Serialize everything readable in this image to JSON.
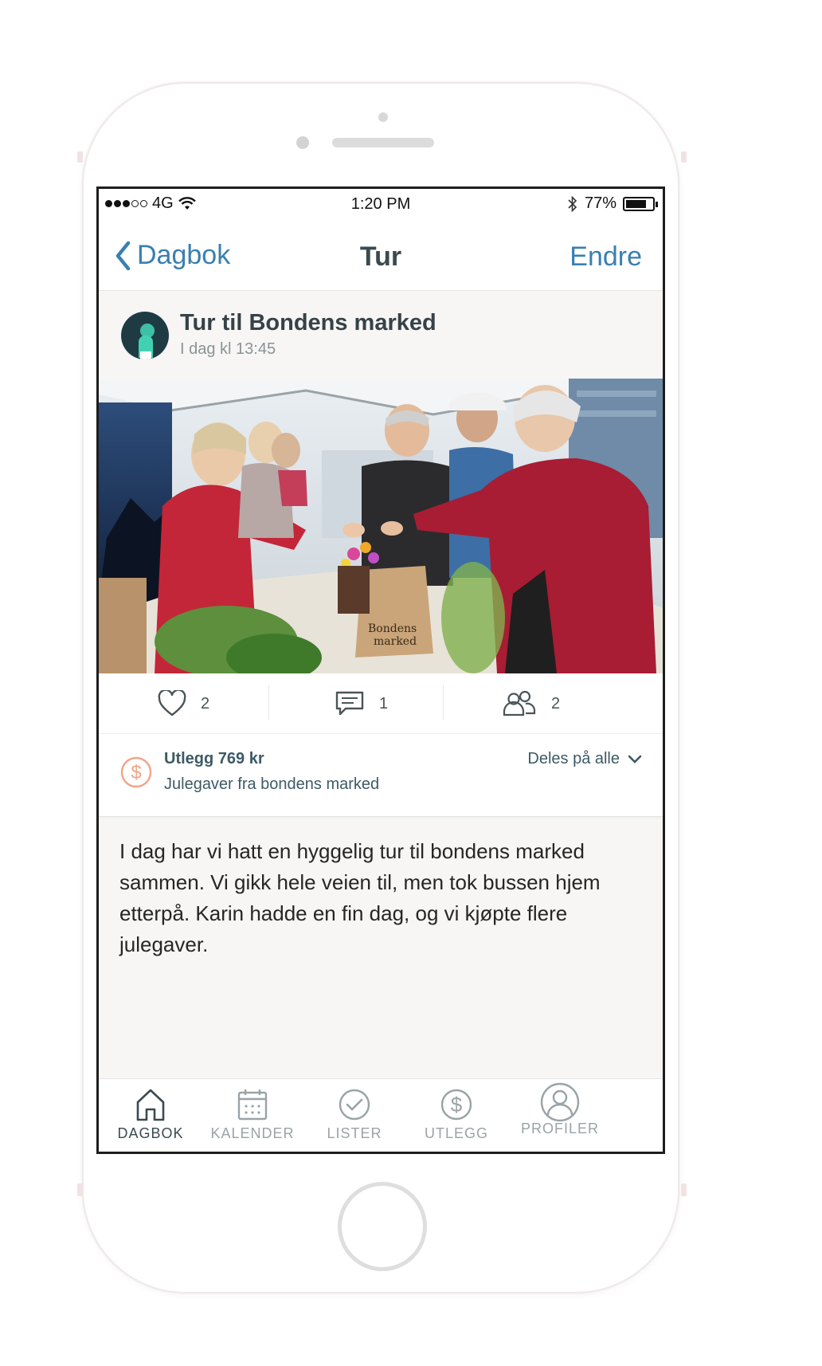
{
  "statusbar": {
    "carrier": "4G",
    "time": "1:20 PM",
    "battery_text": "77%",
    "battery_level": 0.77
  },
  "navbar": {
    "back_label": "Dagbok",
    "title": "Tur",
    "edit_label": "Endre"
  },
  "post": {
    "title": "Tur til Bondens marked",
    "time": "I dag kl 13:45",
    "likes": "2",
    "comments": "1",
    "participants": "2",
    "body": "I dag har vi hatt en hyggelig tur til bondens marked sammen. Vi gikk hele veien til, men tok bussen hjem etterpå. Karin hadde en fin dag, og vi kjøpte flere julegaver."
  },
  "expense": {
    "amount": "Utlegg 769 kr",
    "description": "Julegaver fra bondens marked",
    "share": "Deles på alle"
  },
  "tabbar": {
    "items": [
      {
        "label": "DAGBOK",
        "icon": "home-icon",
        "active": true
      },
      {
        "label": "KALENDER",
        "icon": "calendar-icon",
        "active": false
      },
      {
        "label": "LISTER",
        "icon": "check-circle-icon",
        "active": false
      },
      {
        "label": "UTLEGG",
        "icon": "dollar-circle-icon",
        "active": false
      },
      {
        "label": "PROFILER",
        "icon": "profile-icon",
        "active": false
      }
    ]
  },
  "colors": {
    "accent": "#3a7fb0",
    "expense_icon": "#f2a487",
    "text_dark": "#364247"
  }
}
